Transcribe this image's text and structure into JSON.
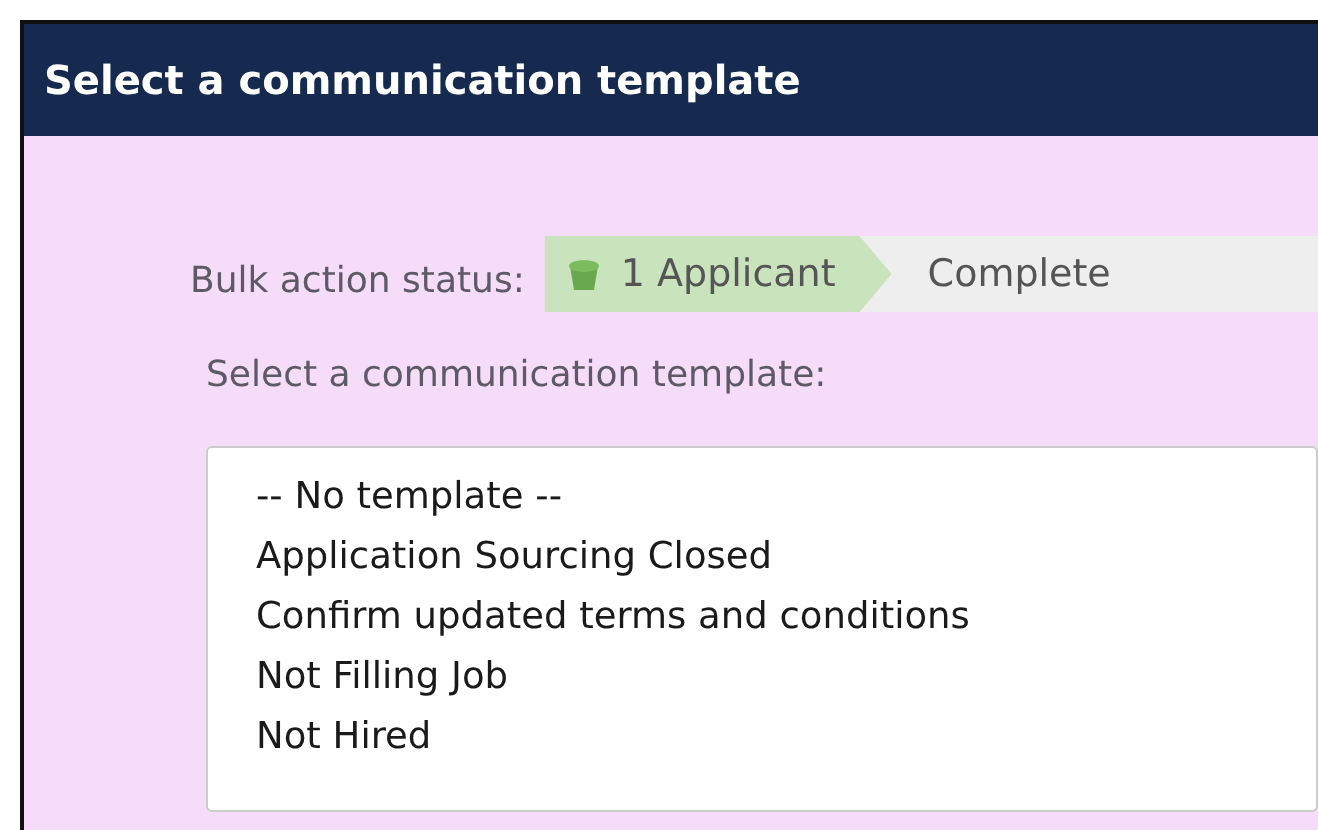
{
  "dialog": {
    "title": "Select a communication template"
  },
  "status": {
    "label": "Bulk action status:",
    "steps": [
      {
        "label": "1 Applicant",
        "done": true
      },
      {
        "label": "Complete",
        "done": false
      }
    ]
  },
  "template_label": "Select a communication template:",
  "templates": [
    {
      "label": "-- No template --",
      "selected": false
    },
    {
      "label": "Application Sourcing Closed",
      "selected": false
    },
    {
      "label": "Confirm updated terms and conditions",
      "selected": false
    },
    {
      "label": "Not Filling Job",
      "selected": false
    },
    {
      "label": "Not Hired",
      "selected": false
    }
  ]
}
